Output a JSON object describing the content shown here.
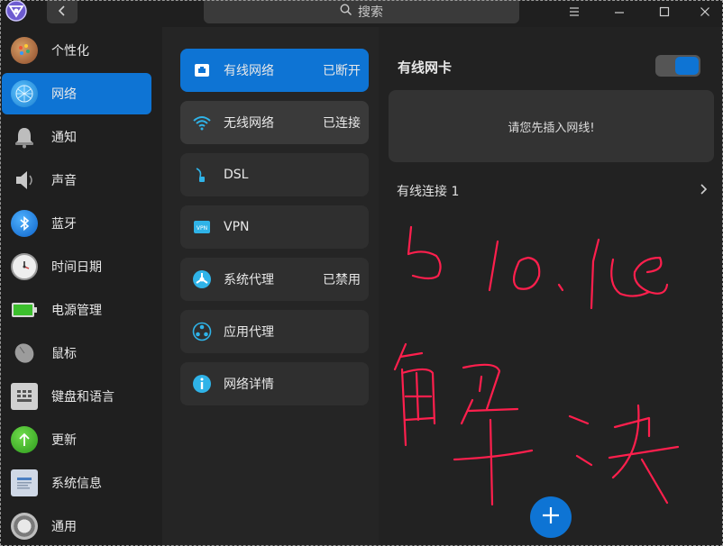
{
  "titlebar": {
    "search_placeholder": "搜索"
  },
  "sidebar": {
    "items": [
      {
        "label": "个性化",
        "icon": "palette-icon"
      },
      {
        "label": "网络",
        "icon": "network-globe-icon"
      },
      {
        "label": "通知",
        "icon": "bell-icon"
      },
      {
        "label": "声音",
        "icon": "speaker-icon"
      },
      {
        "label": "蓝牙",
        "icon": "bluetooth-icon"
      },
      {
        "label": "时间日期",
        "icon": "clock-icon"
      },
      {
        "label": "电源管理",
        "icon": "battery-icon"
      },
      {
        "label": "鼠标",
        "icon": "mouse-icon"
      },
      {
        "label": "键盘和语言",
        "icon": "keyboard-icon"
      },
      {
        "label": "更新",
        "icon": "update-arrow-icon"
      },
      {
        "label": "系统信息",
        "icon": "system-info-icon"
      },
      {
        "label": "通用",
        "icon": "gear-icon"
      }
    ],
    "active_index": 1
  },
  "network_menu": {
    "items": [
      {
        "label": "有线网络",
        "status": "已断开",
        "icon": "wired-network-icon"
      },
      {
        "label": "无线网络",
        "status": "已连接",
        "icon": "wifi-icon"
      },
      {
        "label": "DSL",
        "status": "",
        "icon": "dsl-icon"
      },
      {
        "label": "VPN",
        "status": "",
        "icon": "vpn-icon"
      },
      {
        "label": "系统代理",
        "status": "已禁用",
        "icon": "system-proxy-icon"
      },
      {
        "label": "应用代理",
        "status": "",
        "icon": "app-proxy-icon"
      },
      {
        "label": "网络详情",
        "status": "",
        "icon": "info-icon"
      }
    ]
  },
  "detail": {
    "title": "有线网卡",
    "toggle_on": true,
    "notice": "请您先插入网线!",
    "connection_label": "有线连接 1"
  },
  "annotation": {
    "line1": "5 10.18",
    "line2": "解决"
  },
  "colors": {
    "accent": "#0e74d4",
    "ink": "#ff1f4d"
  }
}
